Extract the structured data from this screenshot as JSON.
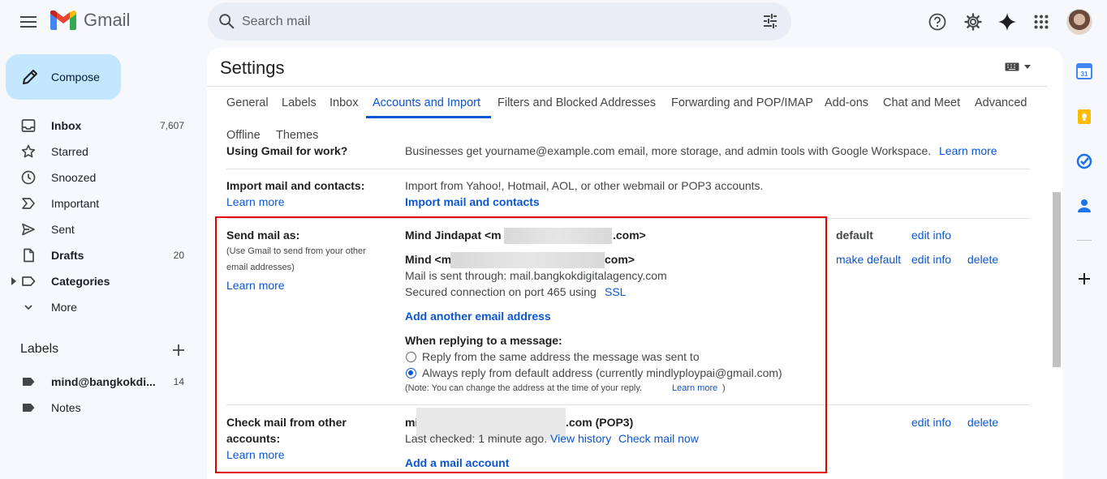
{
  "app": {
    "name": "Gmail"
  },
  "search": {
    "placeholder": "Search mail"
  },
  "sidebar": {
    "compose_label": "Compose",
    "items": [
      {
        "label": "Inbox",
        "count": "7,607",
        "icon": "inbox-icon"
      },
      {
        "label": "Starred",
        "count": "",
        "icon": "star-icon"
      },
      {
        "label": "Snoozed",
        "count": "",
        "icon": "clock-icon"
      },
      {
        "label": "Important",
        "count": "",
        "icon": "important-icon"
      },
      {
        "label": "Sent",
        "count": "",
        "icon": "send-icon"
      },
      {
        "label": "Drafts",
        "count": "20",
        "icon": "draft-icon"
      },
      {
        "label": "Categories",
        "count": "",
        "icon": "label-icon"
      },
      {
        "label": "More",
        "count": "",
        "icon": "chevron-down-icon"
      }
    ],
    "labels_heading": "Labels",
    "labels": [
      {
        "label": "mind@bangkokdi...",
        "count": "14"
      },
      {
        "label": "Notes",
        "count": ""
      }
    ]
  },
  "settings": {
    "title": "Settings",
    "tabs": [
      "General",
      "Labels",
      "Inbox",
      "Accounts and Import",
      "Filters and Blocked Addresses",
      "Forwarding and POP/IMAP",
      "Add-ons",
      "Chat and Meet",
      "Advanced",
      "Offline",
      "Themes"
    ],
    "active_tab": "Accounts and Import",
    "work": {
      "label": "Using Gmail for work?",
      "text": "Businesses get yourname@example.com email, more storage, and admin tools with Google Workspace.",
      "link": "Learn more"
    },
    "import": {
      "label": "Import mail and contacts:",
      "learn_more": "Learn more",
      "text": "Import from Yahoo!, Hotmail, AOL, or other webmail or POP3 accounts.",
      "action": "Import mail and contacts"
    },
    "send_as": {
      "label": "Send mail as:",
      "sub1": "(Use Gmail to send from your other",
      "sub2": "email addresses)",
      "learn_more": "Learn more",
      "addr1_prefix": "Mind Jindapat <m",
      "addr1_suffix": ".com>",
      "addr1_status": "default",
      "addr1_edit": "edit info",
      "addr2_prefix": "Mind <m",
      "addr2_suffix": "com>",
      "addr2_smtp": "Mail is sent through: mail.bangkokdigitalagency.com",
      "addr2_port": "Secured connection on port 465 using",
      "addr2_ssl": "SSL",
      "addr2_make_default": "make default",
      "addr2_edit": "edit info",
      "addr2_delete": "delete",
      "add_another": "Add another email address",
      "reply_heading": "When replying to a message:",
      "reply_opt1": "Reply from the same address the message was sent to",
      "reply_opt2": "Always reply from default address (currently mindlyploypai@gmail.com)",
      "reply_selected": 2,
      "note": "(Note: You can change the address at the time of your reply.",
      "note_link": "Learn more",
      "note_end": ")"
    },
    "check_mail": {
      "label1": "Check mail from other",
      "label2": "accounts:",
      "learn_more": "Learn more",
      "account_prefix": "mi",
      "account_suffix": ".com (POP3)",
      "last_checked": "Last checked: 1 minute ago.",
      "view_history": "View history",
      "check_now": "Check mail now",
      "edit": "edit info",
      "delete": "delete",
      "add_account": "Add a mail account"
    }
  },
  "colors": {
    "accent": "#0b57d0",
    "highlight_box": "#e00000",
    "compose_bg": "#c2e7ff"
  }
}
